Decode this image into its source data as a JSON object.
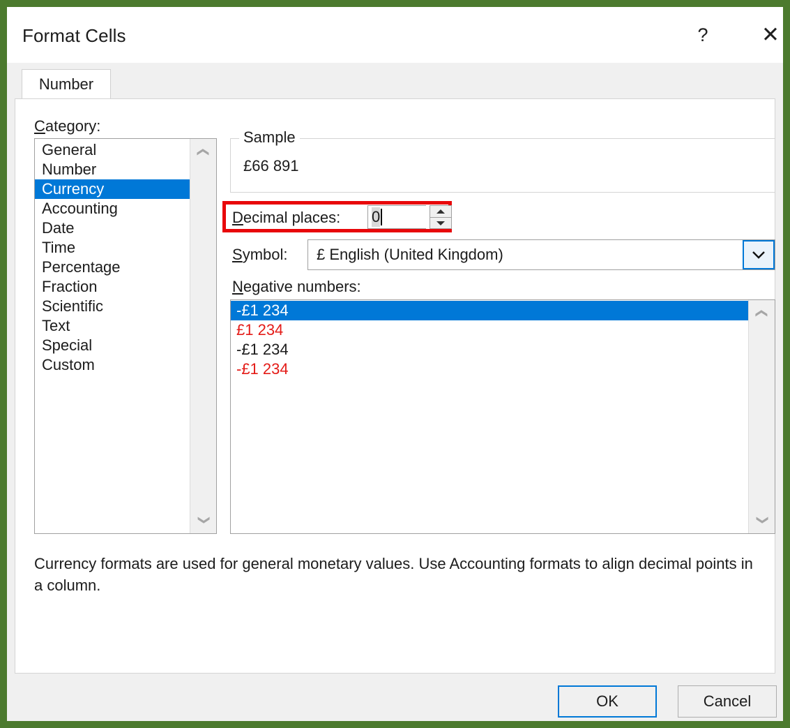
{
  "window": {
    "title": "Format Cells",
    "help_icon": "question-mark-icon",
    "close_icon": "close-icon"
  },
  "tabs": [
    {
      "label": "Number",
      "active": true
    }
  ],
  "category": {
    "label": "Category:",
    "selected": "Currency",
    "items": [
      "General",
      "Number",
      "Currency",
      "Accounting",
      "Date",
      "Time",
      "Percentage",
      "Fraction",
      "Scientific",
      "Text",
      "Special",
      "Custom"
    ]
  },
  "sample": {
    "legend": "Sample",
    "value": "£66 891"
  },
  "decimal_places": {
    "label": "Decimal places:",
    "value": "0",
    "spinner_up_icon": "spinner-up-arrow-icon",
    "spinner_down_icon": "spinner-down-arrow-icon",
    "annotation_color": "#e8070a"
  },
  "symbol": {
    "label": "Symbol:",
    "value": "£ English (United Kingdom)",
    "dropdown_icon": "chevron-down-icon"
  },
  "negative_numbers": {
    "label": "Negative numbers:",
    "selected_index": 0,
    "items": [
      {
        "text": "-£1 234",
        "color": "black",
        "selected": true
      },
      {
        "text": "£1 234",
        "color": "red",
        "selected": false
      },
      {
        "text": "-£1 234",
        "color": "black",
        "selected": false
      },
      {
        "text": "-£1 234",
        "color": "red",
        "selected": false
      }
    ]
  },
  "description": "Currency formats are used for general monetary values.  Use Accounting formats to align decimal points in a column.",
  "footer": {
    "ok_label": "OK",
    "cancel_label": "Cancel"
  },
  "scrollbar": {
    "up_icon": "chevron-up-icon",
    "down_icon": "chevron-down-icon"
  },
  "colors": {
    "outer_frame": "#4c7a2e",
    "selection": "#0078d7",
    "negative_red": "#e41b17",
    "annotation_red": "#e8070a"
  }
}
